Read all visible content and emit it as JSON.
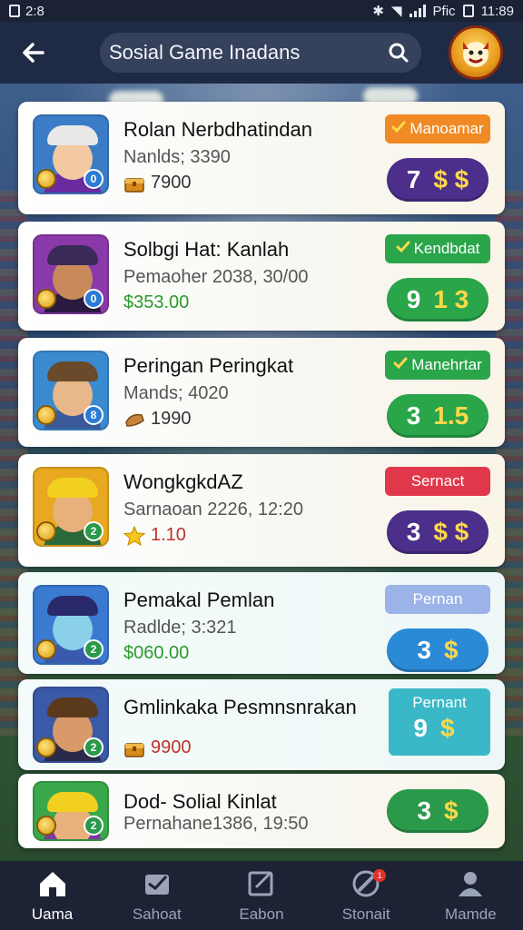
{
  "status_bar": {
    "time_left": "2:8",
    "time_right": "11:89",
    "network": "Pfic"
  },
  "header": {
    "back_icon": "arrow-left-icon",
    "search_text": "Sosial Game Inadans",
    "search_icon": "search-icon",
    "mascot_icon": "trophy-mascot-icon"
  },
  "rows": [
    {
      "name": "Rolan Nerbdhatindan",
      "sub": "Nanlds; 3390",
      "stat": "7900",
      "stat_icon": "treasure-chest-icon",
      "stat_color": "dark",
      "tag": "Manoamar",
      "tag_check": true,
      "tag_color": "#f08a24",
      "score_num": "7",
      "score_sym": "$ $",
      "score_color": "#4b2f8a",
      "avatar_bg": "#3a7cc6",
      "avatar_face": "#f2c9a0",
      "avatar_hat": "#e8e8e8",
      "avatar_body": "#6a2aa0",
      "badge": "0",
      "badge_color": "#2b7bd6"
    },
    {
      "name": "Solbgi Hat: Kanlah",
      "sub": "Pemaoher 2038, 30/00",
      "stat": "$353.00",
      "stat_icon": "",
      "stat_color": "green",
      "tag": "Kendbdat",
      "tag_check": true,
      "tag_color": "#2aa54a",
      "score_num": "9",
      "score_sym": "1 3",
      "score_color": "#2aa54a",
      "avatar_bg": "#8a3aa8",
      "avatar_face": "#c88a5a",
      "avatar_hat": "#3a2a5a",
      "avatar_body": "#2a1a40",
      "badge": "0",
      "badge_color": "#2b7bd6"
    },
    {
      "name": "Peringan Peringkat",
      "sub": "Mands; 4020",
      "stat": "1990",
      "stat_icon": "bread-icon",
      "stat_color": "dark",
      "tag": "Manehrtar",
      "tag_check": true,
      "tag_color": "#2aa54a",
      "score_num": "3",
      "score_sym": "1.5",
      "score_color": "#2aa54a",
      "avatar_bg": "#3a8ad0",
      "avatar_face": "#e8b88a",
      "avatar_hat": "#6a4a2a",
      "avatar_body": "#3a5a9a",
      "badge": "8",
      "badge_color": "#2b7bd6"
    },
    {
      "name": "WongkgkdAZ",
      "sub": "Sarnaoan 2226, 12:20",
      "stat": "1.10",
      "stat_icon": "star-icon",
      "stat_color": "red",
      "tag": "Sernact",
      "tag_check": false,
      "tag_color": "#e0384a",
      "score_num": "3",
      "score_sym": "$ $",
      "score_color": "#4b2f8a",
      "avatar_bg": "#e8a820",
      "avatar_face": "#e8b07a",
      "avatar_hat": "#f2d020",
      "avatar_body": "#2a6a3a",
      "badge": "2",
      "badge_color": "#2a9a4a"
    },
    {
      "name": "Pemakal Pemlan",
      "sub": "Radlde; 3:321",
      "stat": "$060.00",
      "stat_icon": "",
      "stat_color": "green",
      "tag": "Pernan",
      "tag_check": false,
      "tag_color": "#9bb3e8",
      "score_num": "3",
      "score_sym": "$",
      "score_color": "#2b8ad6",
      "avatar_bg": "#3a7ad0",
      "avatar_face": "#8ad0e8",
      "avatar_hat": "#2a2a6a",
      "avatar_body": "#3a5ab0",
      "badge": "2",
      "badge_color": "#2a9a4a"
    },
    {
      "name": "Gmlinkaka Pesmnsnrakan",
      "sub": "",
      "stat": "9900",
      "stat_icon": "treasure-chest-icon",
      "stat_color": "red",
      "tag": "Pernant",
      "tag_check": false,
      "tag_color": "#3ab8c8",
      "score_num": "9",
      "score_sym": "$",
      "score_color": "#3ab8c8",
      "avatar_bg": "#3a5aa8",
      "avatar_face": "#d89a6a",
      "avatar_hat": "#5a3a1a",
      "avatar_body": "#2a2a4a",
      "badge": "2",
      "badge_color": "#2a9a4a"
    },
    {
      "name": "Dod- Solial Kinlat",
      "sub": "Pernahane1386, 19:50",
      "stat": "",
      "stat_icon": "",
      "stat_color": "dark",
      "tag": "",
      "tag_check": false,
      "tag_color": "",
      "score_num": "3",
      "score_sym": "$",
      "score_color": "#2a9a4a",
      "avatar_bg": "#3aa84a",
      "avatar_face": "#e8b07a",
      "avatar_hat": "#f2d020",
      "avatar_body": "#7a3aa0",
      "badge": "2",
      "badge_color": "#2a9a4a"
    }
  ],
  "nav": [
    {
      "label": "Uama",
      "icon": "home-icon",
      "active": true
    },
    {
      "label": "Sahoat",
      "icon": "mail-icon",
      "active": false
    },
    {
      "label": "Eabon",
      "icon": "edit-icon",
      "active": false
    },
    {
      "label": "Stonait",
      "icon": "target-icon",
      "active": false,
      "badge": "1"
    },
    {
      "label": "Mamde",
      "icon": "profile-icon",
      "active": false
    }
  ]
}
